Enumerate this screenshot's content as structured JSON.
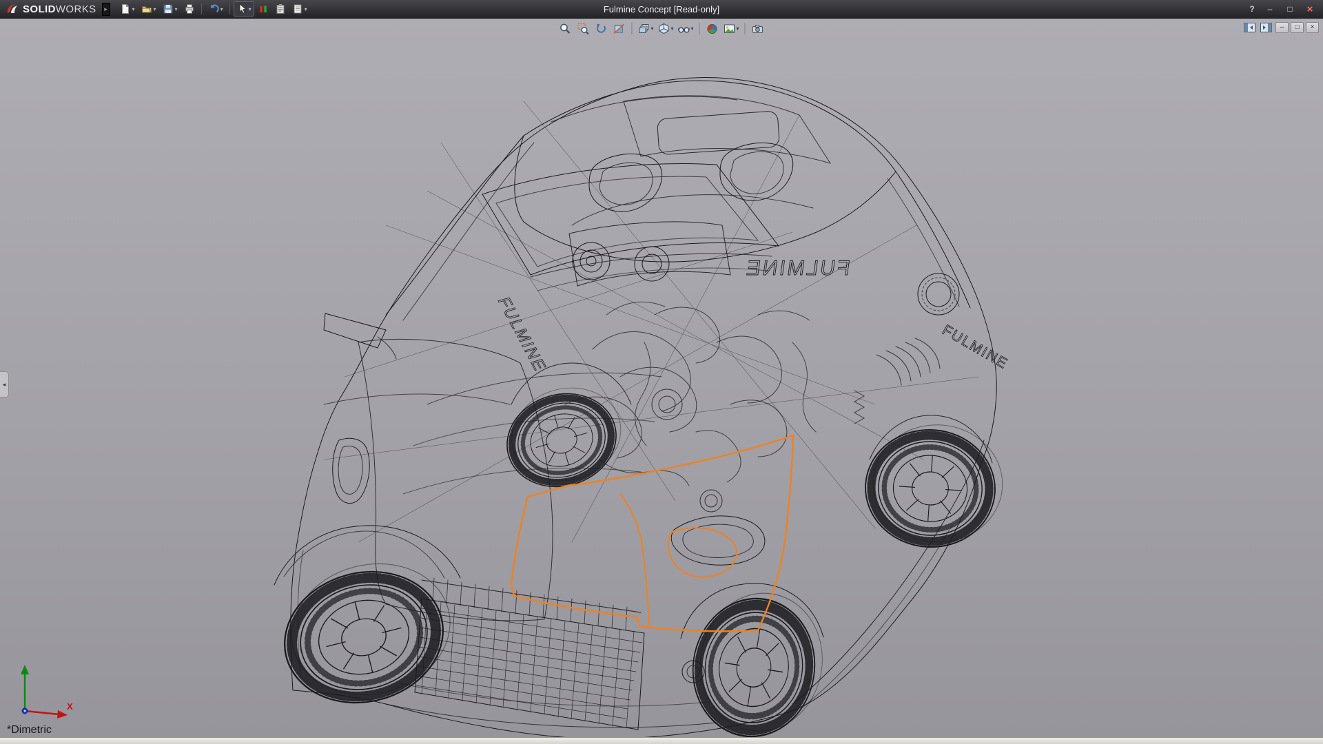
{
  "window": {
    "app_name_bold": "SOLID",
    "app_name_light": "WORKS",
    "title": "Fulmine Concept [Read-only]",
    "view_label": "*Dimetric"
  },
  "glyphs": {
    "caret": "▾",
    "expand_arrow": "▸",
    "collapse_arrow": "◂",
    "help": "?",
    "minimize": "–",
    "maximize": "□",
    "close": "×"
  },
  "main_toolbar": {
    "items": [
      "New Document",
      "Open",
      "Save",
      "Print",
      "Undo",
      "Select",
      "Display States",
      "Document Properties",
      "Options"
    ]
  },
  "heads_up_toolbar": {
    "items": [
      "Zoom to Fit",
      "Zoom to Area",
      "Previous View",
      "Section View",
      "View Orientation",
      "Display Style",
      "Hide/Show Items",
      "Edit Appearance",
      "Apply Scene",
      "View Settings"
    ]
  },
  "viewport_controls": {
    "items": [
      "FeatureManager Pane",
      "Task Pane",
      "Minimize",
      "Restore",
      "Close"
    ]
  },
  "model": {
    "badge_text": "FULMINE",
    "sketch_color": "#EF8221"
  },
  "triad": {
    "x_label": "X"
  },
  "colors": {
    "titlebar_top": "#47474b",
    "titlebar_bg": "#242428",
    "viewport_top": "#aeadb3",
    "viewport_bottom": "#96959b",
    "sketch_orange": "#EF8221",
    "wireframe": "#1a1a1e"
  }
}
